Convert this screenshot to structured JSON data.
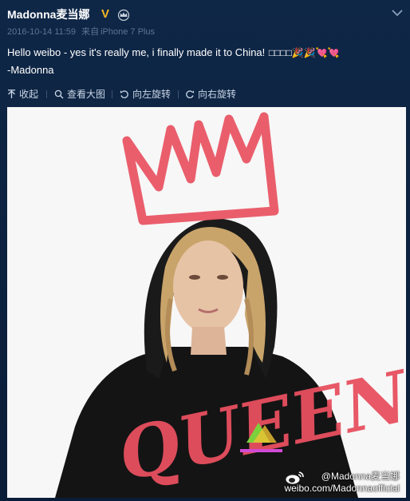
{
  "post": {
    "username": "Madonna麦当娜",
    "vip_badge": "V",
    "crown_icon": "crown-icon",
    "more_icon": "chevron-down-icon",
    "timestamp": "2016-10-14 11:59",
    "source_prefix": "来自",
    "source": "iPhone 7 Plus",
    "text_line1": "Hello weibo - yes it's really me, i finally made it to China!",
    "text_emojis": "□□□□🎉🎉💘💘",
    "text_line2": "-Madonna"
  },
  "toolbar": {
    "collapse": "收起",
    "view_large": "查看大图",
    "rotate_left": "向左旋转",
    "rotate_right": "向右旋转"
  },
  "image": {
    "crown_text": "MM",
    "word": "QUEEN",
    "watermark_handle": "@Madonna麦当娜",
    "watermark_url": "weibo.com/Madonnaofficial"
  },
  "colors": {
    "background": "#0b1f3a",
    "accent_pink": "#e8505f",
    "meta_gray": "#5d7593",
    "vip_gold": "#f2b824"
  }
}
